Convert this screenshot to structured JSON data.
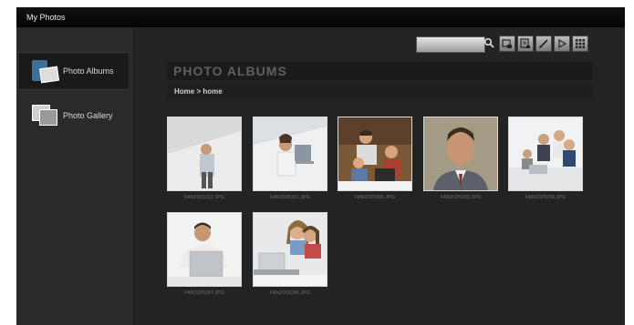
{
  "window": {
    "title": "My Photos"
  },
  "sidebar": {
    "items": [
      {
        "label": "Photo Albums",
        "icon": "photo-album-icon",
        "active": true
      },
      {
        "label": "Photo Gallery",
        "icon": "photo-gallery-icon",
        "active": false
      }
    ]
  },
  "toolbar": {
    "search_value": "",
    "buttons": [
      "search-icon",
      "slideshow-icon",
      "export-icon",
      "edit-icon",
      "play-icon",
      "grid-view-icon"
    ]
  },
  "main": {
    "title": "PHOTO ALBUMS",
    "breadcrumb": "Home > home",
    "photos": [
      {
        "filename": "FAN2025312.JPG",
        "scene": "office-person-phone"
      },
      {
        "filename": "FAN2025311.JPG",
        "scene": "office-woman-laptop"
      },
      {
        "filename": "FAN2025306.JPG",
        "scene": "family-computer"
      },
      {
        "filename": "FAN2025303.JPG",
        "scene": "man-portrait"
      },
      {
        "filename": "FAN2025290.JPG",
        "scene": "group-meeting"
      },
      {
        "filename": "FAN2025287.JPG",
        "scene": "man-laptop-smile"
      },
      {
        "filename": "FAN2025286.JPG",
        "scene": "girls-laptop"
      }
    ]
  },
  "colors": {
    "window_bg": "#232323",
    "titlebar_bg": "#0a0a0a",
    "text_light": "#d8d8d8",
    "photo_border": "#d8d8d8"
  }
}
